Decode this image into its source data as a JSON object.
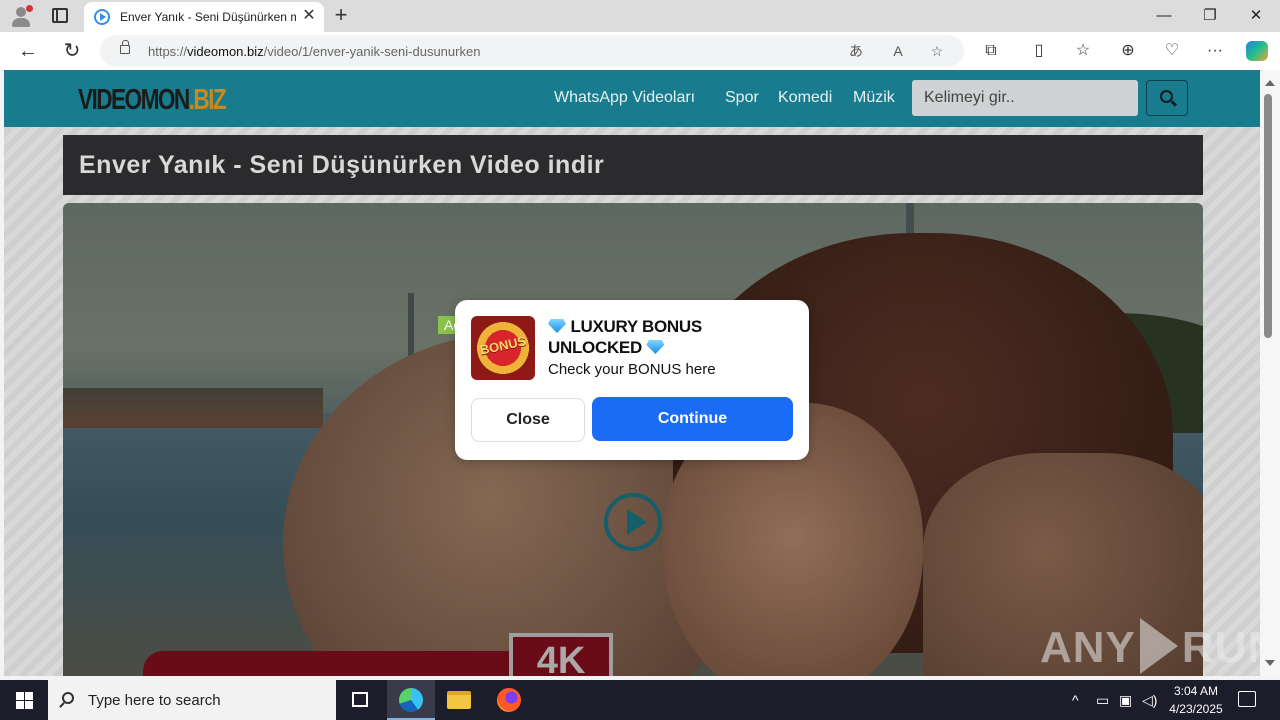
{
  "browser": {
    "tab_title": "Enver Yanık - Seni Düşünürken m",
    "tab_close": "✕",
    "new_tab": "+",
    "window_controls": {
      "minimize": "—",
      "restore": "❐",
      "close": "✕"
    },
    "nav": {
      "back": "←",
      "refresh": "↻"
    },
    "url_prefix": "https://",
    "url_domain": "videomon.biz",
    "url_path": "/video/1/enver-yanik-seni-dusunurken",
    "omnibox_icons": [
      "translate-icon",
      "read-aloud-icon",
      "favorite-star-icon"
    ],
    "toolbar_icons": [
      "extensions-icon",
      "split-screen-icon",
      "favorites-icon",
      "collections-icon",
      "browser-essentials-icon",
      "more-icon",
      "copilot-icon"
    ]
  },
  "site": {
    "logo_main": "VIDEOMON",
    "logo_tld": ".BIZ",
    "menu": [
      {
        "label": "WhatsApp Videoları"
      },
      {
        "label": "Spor"
      },
      {
        "label": "Komedi"
      },
      {
        "label": "Müzik"
      }
    ],
    "search_placeholder": "Kelimeyi gir..",
    "page_title": "Enver Yanık - Seni Düşünürken Video indir",
    "video_badge": "4K"
  },
  "ad": {
    "badge": "Ad",
    "logo_text": "BONUS",
    "headline": "LUXURY BONUS UNLOCKED",
    "subtext": "Check your BONUS here",
    "close_label": "Close",
    "continue_label": "Continue",
    "continue_color": "#1a6cf6"
  },
  "watermark": {
    "left": "ANY",
    "right": "RUN"
  },
  "taskbar": {
    "search_placeholder": "Type here to search",
    "apps": [
      "task-view-icon",
      "edge-icon",
      "file-explorer-icon",
      "firefox-icon"
    ],
    "time": "3:04 AM",
    "date": "4/23/2025"
  },
  "colors": {
    "site_header": "#187c8e",
    "title_bar": "#2b2b2e",
    "logo_accent": "#c68a24",
    "ad_badge": "#8bc34a"
  }
}
